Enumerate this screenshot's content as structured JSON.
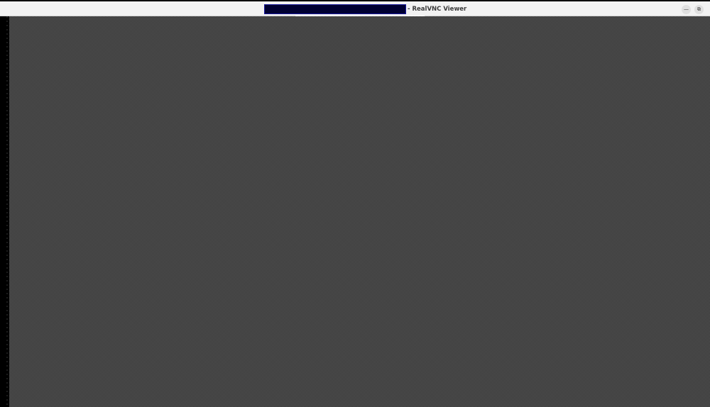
{
  "window": {
    "title_suffix": "- RealVNC Viewer",
    "buttons": {
      "minimize_glyph": "—",
      "restore_glyph": "⧉"
    }
  },
  "colors": {
    "titlebar_bg": "#f2f2f2",
    "redaction_fill": "#000033",
    "redaction_border": "#1a1aa0",
    "desktop_dark": "#2e2e2e",
    "desktop_light": "#5c5c5c"
  },
  "icons": [
    "minimize-icon",
    "restore-icon"
  ]
}
